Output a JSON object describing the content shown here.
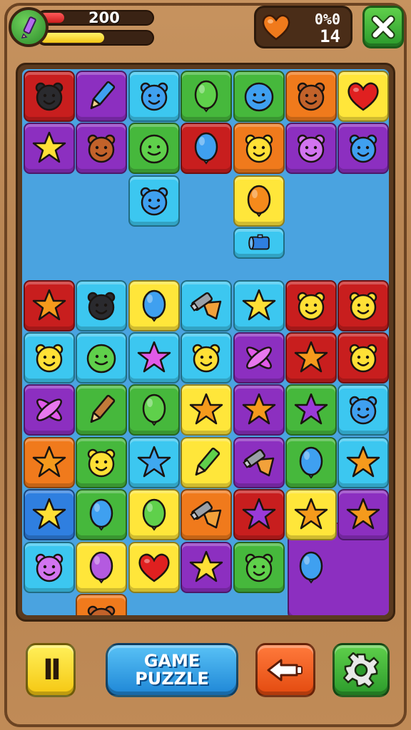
{
  "hud": {
    "score": "200",
    "health_fraction": 0.22,
    "progress_fraction": 0.58,
    "stat_top": "0%0",
    "stat_bottom": "14"
  },
  "colors": {
    "red": "#c81e1e",
    "purple": "#8c2fc0",
    "cyan": "#3cc7f0",
    "green": "#46b83c",
    "orange": "#f07a1c",
    "yellow": "#ffe63a",
    "blue": "#2f7fe0",
    "board_blue": "#4aa3e0"
  },
  "grid": {
    "rows": 10,
    "cols": 7,
    "tiles": [
      {
        "r": 0,
        "c": 0,
        "color": "red",
        "icon": "black-bear-icon"
      },
      {
        "r": 0,
        "c": 1,
        "color": "purple",
        "icon": "pencil-icon"
      },
      {
        "r": 0,
        "c": 2,
        "color": "cyan",
        "icon": "blue-bear-icon"
      },
      {
        "r": 0,
        "c": 3,
        "color": "green",
        "icon": "green-balloon-icon"
      },
      {
        "r": 0,
        "c": 4,
        "color": "green",
        "icon": "blue-blob-icon"
      },
      {
        "r": 0,
        "c": 5,
        "color": "orange",
        "icon": "brown-bear-icon"
      },
      {
        "r": 0,
        "c": 6,
        "color": "yellow",
        "icon": "heart-icon"
      },
      {
        "r": 1,
        "c": 0,
        "color": "purple",
        "icon": "star-icon"
      },
      {
        "r": 1,
        "c": 1,
        "color": "purple",
        "icon": "brown-bear-icon"
      },
      {
        "r": 1,
        "c": 2,
        "color": "green",
        "icon": "green-blob-icon"
      },
      {
        "r": 1,
        "c": 3,
        "color": "red",
        "icon": "blue-balloon-icon"
      },
      {
        "r": 1,
        "c": 4,
        "color": "orange",
        "icon": "yellow-bear-icon"
      },
      {
        "r": 1,
        "c": 5,
        "color": "purple",
        "icon": "pink-bear-icon"
      },
      {
        "r": 1,
        "c": 6,
        "color": "purple",
        "icon": "blue-bear-icon"
      },
      {
        "r": 2,
        "c": 2,
        "color": "cyan",
        "icon": "blue-bear-icon"
      },
      {
        "r": 2,
        "c": 4,
        "color": "yellow",
        "icon": "orange-balloon-icon"
      },
      {
        "r": 3,
        "c": 4,
        "color": "cyan",
        "icon": "blue-barrel-icon",
        "half": true
      },
      {
        "r": 4,
        "c": 0,
        "color": "red",
        "icon": "orange-star-icon"
      },
      {
        "r": 4,
        "c": 1,
        "color": "cyan",
        "icon": "black-bear-icon"
      },
      {
        "r": 4,
        "c": 2,
        "color": "yellow",
        "icon": "blue-balloon-icon"
      },
      {
        "r": 4,
        "c": 3,
        "color": "cyan",
        "icon": "hammer-icon"
      },
      {
        "r": 4,
        "c": 4,
        "color": "cyan",
        "icon": "star-icon"
      },
      {
        "r": 4,
        "c": 5,
        "color": "red",
        "icon": "yellow-bear-icon"
      },
      {
        "r": 4,
        "c": 6,
        "color": "red",
        "icon": "yellow-bear-icon"
      },
      {
        "r": 5,
        "c": 0,
        "color": "cyan",
        "icon": "yellow-bear-icon"
      },
      {
        "r": 5,
        "c": 1,
        "color": "cyan",
        "icon": "green-blob-icon"
      },
      {
        "r": 5,
        "c": 2,
        "color": "cyan",
        "icon": "pink-star-icon"
      },
      {
        "r": 5,
        "c": 3,
        "color": "cyan",
        "icon": "yellow-bear-icon"
      },
      {
        "r": 5,
        "c": 4,
        "color": "purple",
        "icon": "pink-cross-icon"
      },
      {
        "r": 5,
        "c": 5,
        "color": "red",
        "icon": "orange-star-icon"
      },
      {
        "r": 5,
        "c": 6,
        "color": "red",
        "icon": "yellow-bear-icon"
      },
      {
        "r": 6,
        "c": 0,
        "color": "purple",
        "icon": "pink-cross-icon"
      },
      {
        "r": 6,
        "c": 1,
        "color": "green",
        "icon": "brown-pencil-icon"
      },
      {
        "r": 6,
        "c": 2,
        "color": "green",
        "icon": "green-balloon-icon"
      },
      {
        "r": 6,
        "c": 3,
        "color": "yellow",
        "icon": "orange-star-icon"
      },
      {
        "r": 6,
        "c": 4,
        "color": "purple",
        "icon": "orange-star-icon"
      },
      {
        "r": 6,
        "c": 5,
        "color": "green",
        "icon": "purple-star-icon"
      },
      {
        "r": 6,
        "c": 6,
        "color": "cyan",
        "icon": "blue-bear-icon"
      },
      {
        "r": 7,
        "c": 0,
        "color": "orange",
        "icon": "orange-star-icon"
      },
      {
        "r": 7,
        "c": 1,
        "color": "green",
        "icon": "yellow-bear-icon"
      },
      {
        "r": 7,
        "c": 2,
        "color": "cyan",
        "icon": "blue-star-icon"
      },
      {
        "r": 7,
        "c": 3,
        "color": "yellow",
        "icon": "green-pencil-icon"
      },
      {
        "r": 7,
        "c": 4,
        "color": "purple",
        "icon": "hammer-icon"
      },
      {
        "r": 7,
        "c": 5,
        "color": "green",
        "icon": "blue-balloon-icon"
      },
      {
        "r": 7,
        "c": 6,
        "color": "cyan",
        "icon": "orange-star-icon"
      },
      {
        "r": 8,
        "c": 0,
        "color": "blue",
        "icon": "star-icon"
      },
      {
        "r": 8,
        "c": 1,
        "color": "green",
        "icon": "blue-balloon-icon"
      },
      {
        "r": 8,
        "c": 2,
        "color": "yellow",
        "icon": "green-balloon-icon"
      },
      {
        "r": 8,
        "c": 3,
        "color": "orange",
        "icon": "hammer-icon"
      },
      {
        "r": 8,
        "c": 4,
        "color": "red",
        "icon": "purple-star-icon"
      },
      {
        "r": 8,
        "c": 5,
        "color": "yellow",
        "icon": "orange-star-icon"
      },
      {
        "r": 8,
        "c": 6,
        "color": "purple",
        "icon": "orange-star-icon"
      },
      {
        "r": 9,
        "c": 0,
        "color": "cyan",
        "icon": "pink-bear-icon"
      },
      {
        "r": 9,
        "c": 1,
        "color": "yellow",
        "icon": "purple-balloon-icon"
      },
      {
        "r": 9,
        "c": 2,
        "color": "yellow",
        "icon": "heart-icon"
      },
      {
        "r": 9,
        "c": 3,
        "color": "purple",
        "icon": "star-icon"
      },
      {
        "r": 9,
        "c": 4,
        "color": "green",
        "icon": "green-bear-icon"
      },
      {
        "r": 9,
        "c": 5,
        "color": "purple",
        "icon": "blue-balloon-icon",
        "bare": true
      },
      {
        "r": 10,
        "c": 1,
        "color": "orange",
        "icon": "brown-bear-icon"
      }
    ]
  },
  "controls": {
    "pause_label": "II",
    "game_line1": "GAME",
    "game_line2": "PUZZLE"
  }
}
